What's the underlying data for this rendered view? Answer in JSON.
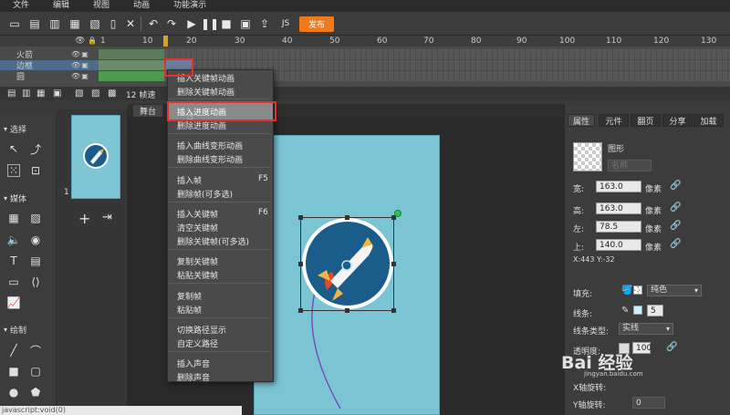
{
  "menubar": {
    "items": [
      "文件",
      "编辑",
      "视图",
      "动画",
      "功能演示"
    ]
  },
  "toolbar": {
    "icons": [
      "new-file-icon",
      "save-icon",
      "cut-icon",
      "copy-icon",
      "paste-icon",
      "delete-icon",
      "undo-icon",
      "redo-icon",
      "play-icon",
      "pause-icon",
      "stop-icon",
      "preview-icon",
      "export-icon",
      "js-icon"
    ],
    "publish_label": "发布"
  },
  "timeline": {
    "ticks": [
      "1",
      "10",
      "20",
      "30",
      "40",
      "50",
      "60",
      "70",
      "80",
      "90",
      "100",
      "110",
      "120",
      "130",
      "140",
      "150",
      "160",
      "170",
      "180"
    ],
    "layers": [
      {
        "name": "火箭"
      },
      {
        "name": "边框"
      },
      {
        "name": "圆"
      }
    ],
    "fps_label": "12 帧速"
  },
  "lefttools": {
    "sections": [
      "选择",
      "媒体",
      "绘制"
    ]
  },
  "pages": {
    "page_number": "1"
  },
  "stage": {
    "tab_label": "舞台"
  },
  "context_menu": {
    "groups": [
      [
        {
          "label": "插入关键帧动画"
        },
        {
          "label": "删除关键帧动画"
        }
      ],
      [
        {
          "label": "插入进度动画"
        },
        {
          "label": "删除进度动画"
        }
      ],
      [
        {
          "label": "插入曲线变形动画"
        },
        {
          "label": "删除曲线变形动画"
        }
      ],
      [
        {
          "label": "插入帧",
          "key": "F5"
        },
        {
          "label": "删除帧(可多选)"
        }
      ],
      [
        {
          "label": "插入关键帧",
          "key": "F6"
        },
        {
          "label": "清空关键帧"
        },
        {
          "label": "删除关键帧(可多选)"
        }
      ],
      [
        {
          "label": "复制关键帧"
        },
        {
          "label": "粘贴关键帧"
        }
      ],
      [
        {
          "label": "复制帧"
        },
        {
          "label": "粘贴帧"
        }
      ],
      [
        {
          "label": "切换路径显示"
        },
        {
          "label": "自定义路径"
        }
      ],
      [
        {
          "label": "插入声音"
        },
        {
          "label": "删除声音"
        }
      ]
    ]
  },
  "rpanel": {
    "tabs": [
      "属性",
      "元件",
      "翻页",
      "分享",
      "加载"
    ],
    "type_label": "图形",
    "name_placeholder": "名称",
    "fields": [
      {
        "label": "宽:",
        "value": "163.0",
        "unit": "像素"
      },
      {
        "label": "高:",
        "value": "163.0",
        "unit": "像素"
      },
      {
        "label": "左:",
        "value": "78.5",
        "unit": "像素"
      },
      {
        "label": "上:",
        "value": "140.0",
        "unit": "像素"
      }
    ],
    "coords": "X:443    Y:-32",
    "fill_label": "填充:",
    "fill_mode": "纯色",
    "stroke_label": "线条:",
    "stroke_width": "5",
    "stroke_type_label": "线条类型:",
    "stroke_type": "实线",
    "opacity_label": "透明度:",
    "opacity_value": "100",
    "rotation_label": "Y轴旋转:",
    "rotation_value": "0",
    "xrot_label": "X轴旋转:"
  },
  "statusbar": {
    "text": "javascript:void(0)"
  },
  "watermark": {
    "brand": "Bai 经验",
    "sub": "jingyan.baidu.com"
  },
  "colors": {
    "accent": "#f07a1b",
    "canvas": "#7bc4d4",
    "highlight": "#e53030",
    "rocket_bg": "#1a5c8a"
  }
}
